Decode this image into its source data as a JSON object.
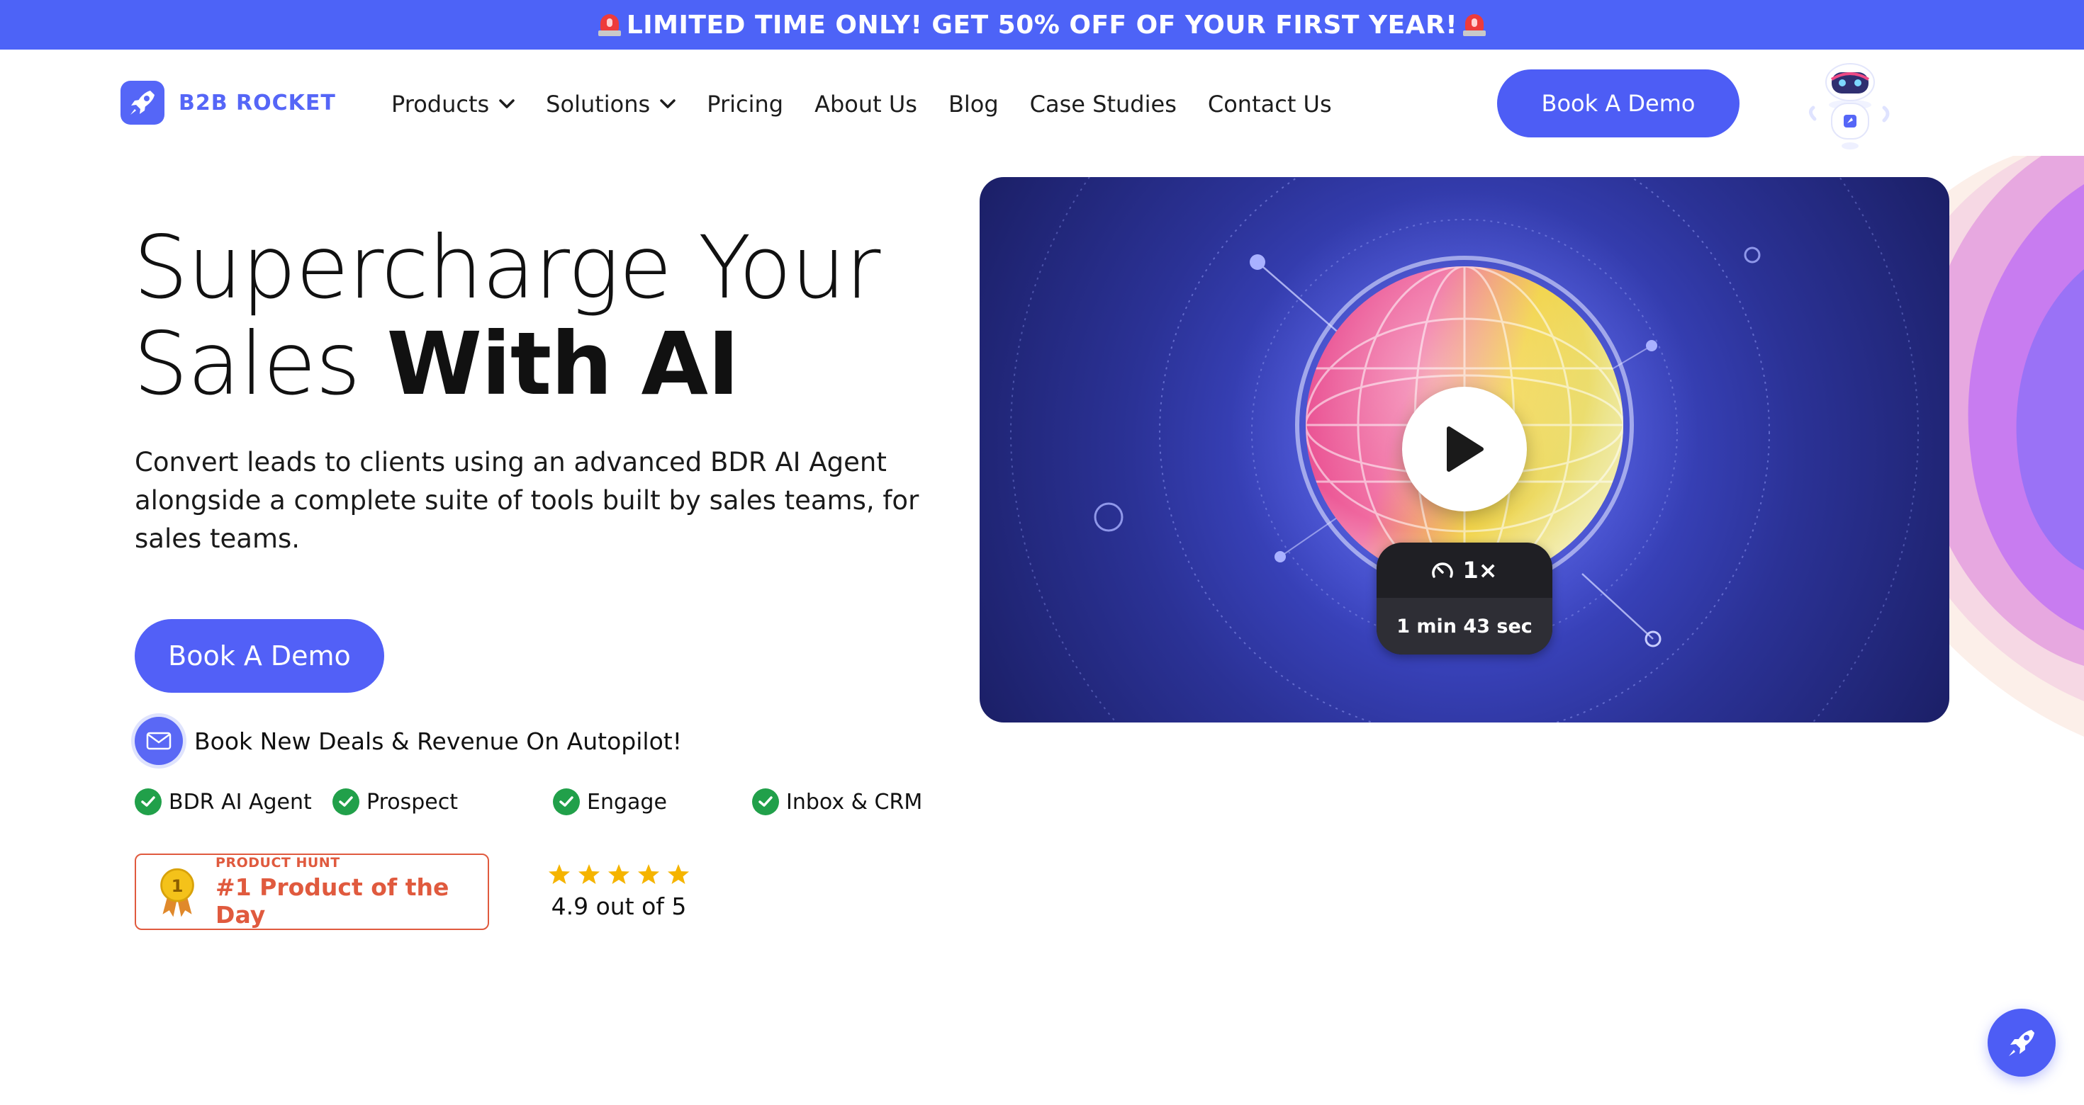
{
  "banner": {
    "text": "LIMITED TIME ONLY! GET 50% OFF OF YOUR FIRST YEAR!"
  },
  "header": {
    "logo_text": "B2B ROCKET",
    "nav": [
      {
        "label": "Products",
        "has_dropdown": true
      },
      {
        "label": "Solutions",
        "has_dropdown": true
      },
      {
        "label": "Pricing",
        "has_dropdown": false
      },
      {
        "label": "About Us",
        "has_dropdown": false
      },
      {
        "label": "Blog",
        "has_dropdown": false
      },
      {
        "label": "Case Studies",
        "has_dropdown": false
      },
      {
        "label": "Contact Us",
        "has_dropdown": false
      }
    ],
    "cta_label": "Book A Demo"
  },
  "hero": {
    "title_line1": "Supercharge Your",
    "title_line2_light": "Sales ",
    "title_line2_bold": "With AI",
    "subtitle": "Convert leads to clients using an advanced BDR AI Agent alongside a complete suite of tools built by sales teams, for sales teams.",
    "cta_label": "Book A Demo",
    "tagline": "Book New Deals & Revenue On Autopilot!",
    "features": [
      "BDR AI Agent",
      "Prospect",
      "Engage",
      "Inbox & CRM"
    ],
    "product_hunt": {
      "small": "PRODUCT HUNT",
      "big": "#1 Product of the Day",
      "medal_number": "1"
    },
    "rating": {
      "stars": 5,
      "text": "4.9 out of 5"
    }
  },
  "video": {
    "speed": "1×",
    "duration": "1 min 43 sec"
  },
  "colors": {
    "brand": "#4d5df5",
    "banner": "#4d63f7",
    "success": "#21a04a",
    "product_hunt": "#e05a3e",
    "star": "#f5b400"
  },
  "icons": {
    "banner": "siren-icon",
    "nav_dropdown": "chevron-down-icon",
    "tagline": "mail-icon",
    "feature": "check-circle-icon",
    "play": "play-icon",
    "speed": "gauge-icon",
    "float": "rocket-icon"
  }
}
